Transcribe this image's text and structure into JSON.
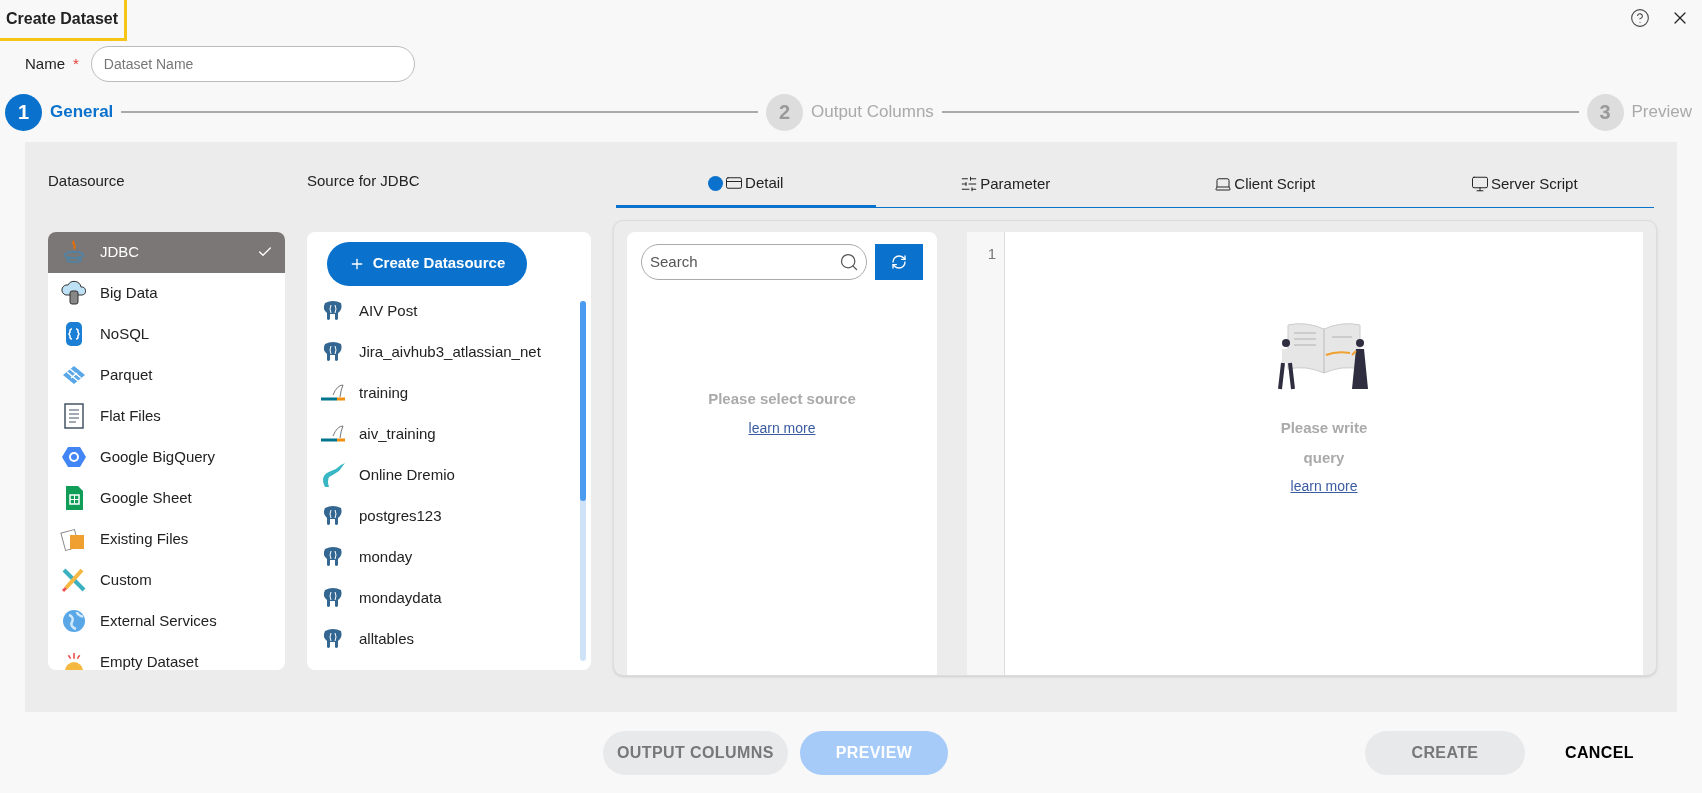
{
  "window": {
    "title": "Create Dataset"
  },
  "name_field": {
    "label": "Name",
    "required_mark": "*",
    "placeholder": "Dataset Name"
  },
  "steps": [
    {
      "number": "1",
      "label": "General",
      "selected": true
    },
    {
      "number": "2",
      "label": "Output Columns",
      "selected": false
    },
    {
      "number": "3",
      "label": "Preview",
      "selected": false
    }
  ],
  "datasource": {
    "heading": "Datasource",
    "items": [
      {
        "label": "JDBC",
        "selected": true
      },
      {
        "label": "Big Data",
        "selected": false
      },
      {
        "label": "NoSQL",
        "selected": false
      },
      {
        "label": "Parquet",
        "selected": false
      },
      {
        "label": "Flat Files",
        "selected": false
      },
      {
        "label": "Google BigQuery",
        "selected": false
      },
      {
        "label": "Google Sheet",
        "selected": false
      },
      {
        "label": "Existing Files",
        "selected": false
      },
      {
        "label": "Custom",
        "selected": false
      },
      {
        "label": "External Services",
        "selected": false
      },
      {
        "label": "Empty Dataset",
        "selected": false
      }
    ]
  },
  "sources": {
    "heading": "Source for JDBC",
    "create_button": "Create Datasource",
    "items": [
      {
        "label": "AIV Post",
        "kind": "postgres"
      },
      {
        "label": "Jira_aivhub3_atlassian_net",
        "kind": "postgres"
      },
      {
        "label": "training",
        "kind": "mysql"
      },
      {
        "label": "aiv_training",
        "kind": "mysql"
      },
      {
        "label": "Online Dremio",
        "kind": "dremio"
      },
      {
        "label": "postgres123",
        "kind": "postgres"
      },
      {
        "label": "monday",
        "kind": "postgres"
      },
      {
        "label": "mondaydata",
        "kind": "postgres"
      },
      {
        "label": "alltables",
        "kind": "postgres"
      }
    ]
  },
  "tabs": [
    {
      "label": "Detail",
      "selected": true
    },
    {
      "label": "Parameter",
      "selected": false
    },
    {
      "label": "Client Script",
      "selected": false
    },
    {
      "label": "Server Script",
      "selected": false
    }
  ],
  "detail": {
    "search": {
      "placeholder": "Search"
    },
    "empty_message": "Please select source",
    "learn_more": "learn more"
  },
  "editor": {
    "line_number": "1",
    "empty_message_lines": [
      "Please write",
      "query"
    ],
    "learn_more": "learn more"
  },
  "footer": {
    "buttons": [
      {
        "label": "OUTPUT COLUMNS",
        "kind": "secondary"
      },
      {
        "label": "PREVIEW",
        "kind": "primary-disabled"
      }
    ],
    "actions": [
      {
        "label": "CREATE",
        "kind": "secondary"
      },
      {
        "label": "CANCEL",
        "kind": "text"
      }
    ]
  }
}
